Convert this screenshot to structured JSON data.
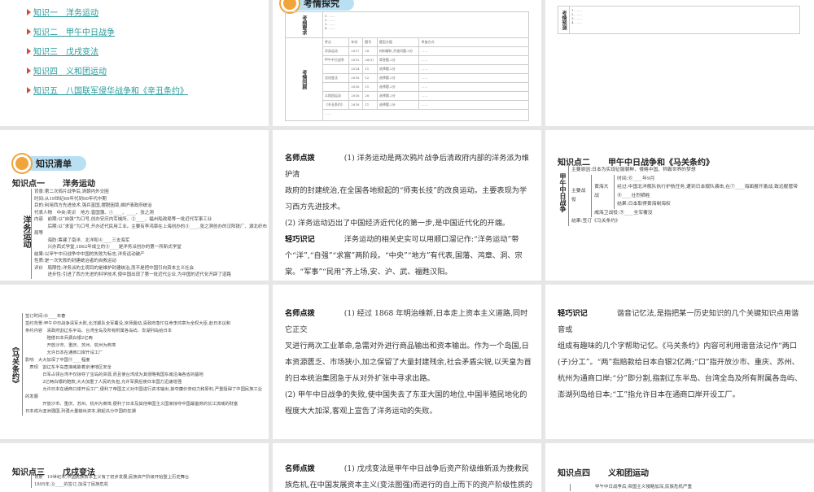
{
  "toc": {
    "items": [
      "知识一　洋务运动",
      "知识二　甲午中日战争",
      "知识三　戊戌变法",
      "知识四　义和团运动",
      "知识五　八国联军侵华战争和《辛丑条约》"
    ]
  },
  "exam": {
    "badge": "考情探究",
    "req_label": "考纲要求",
    "review_label": "考情回顾",
    "headers": [
      "考点",
      "年份",
      "题号",
      "题型分值",
      "考查方式"
    ],
    "rows": [
      [
        "洋务运动",
        "2017",
        "28",
        "材料解析,开放问题,9分"
      ],
      [
        "甲午中日战争",
        "2015",
        "28(1)",
        "简答题,2分"
      ],
      [
        "",
        "2014",
        "11",
        "选择题,2分"
      ],
      [
        "戊戌变法",
        "2018",
        "12",
        "选择题,2分"
      ],
      [
        "",
        "2016",
        "11",
        "选择题,2分"
      ],
      [
        "义和团运动",
        "2016",
        "28",
        "选择题,2分"
      ],
      [
        "《辛丑条约》",
        "2018",
        "11",
        "选择题,2分"
      ]
    ],
    "forecast_label": "考情预测"
  },
  "list": {
    "badge": "知识清单",
    "k1_num": "知识点一",
    "k1_title": "洋务运动",
    "k1_side": "洋务运动",
    "k1_lines": [
      "背景:第二次鸦片战争后,清朝内外交困",
      "时间:从19世纪60年代到90年代中期",
      "目的:利用西方先进技术,强兵富国,摆脱困境,维护清政府统治",
      "代表人物　中央:奕䜣　地方:曾国藩、①____、____、张之洞",
      "内容　前期:以“自强”为口号,创办安庆内军械所、②____、福州船政局等一批近代军事工业",
      "　　　后期:以“求富”为口号,开办近代民用工业。主要有李鸿章在上海创办的③____,张之洞创办的汉阳铁厂、湖北织布局等",
      "　　　海防:筹建了南洋、北洋和④____三支海军",
      "　　　兴办西式学堂,1862年成立的⑤____是洋务派创办的第一所新式学堂",
      "结果:以甲午中日战争中中国的失败为标志,洋务运动破产",
      "性质:是一次失败的封建统治者的自救运动",
      "评价　局限性:洋务派的主观目的是维护封建统治,而不是把中国引向资本主义社会",
      "　　　进步性:引进了西方先进的科学技术,使中国出现了第一批近代企业,为中国的近代化开辟了道路"
    ]
  },
  "tip1": {
    "label": "名师点拨",
    "p1": "(1) 洋务运动是两次鸦片战争后清政府内部的洋务派为维护清",
    "p1b": "政府的封建统治,在全国各地掀起的“师夷长技”的改良运动。主要表现为学习西方先进技术。",
    "p2": "(2) 洋务运动迈出了中国经济近代化的第一步,是中国近代化的开端。",
    "label2": "轻巧识记",
    "p3": "洋务运动的相关史实可以用顺口溜记作:“洋务运动”带个“洋”,“自强”“求富”两阶段。“中央”“地方”有代表,国藩、鸿章、洞、宗棠。“军事”“民用”齐上场,安、沪、武、福甦汉阳。"
  },
  "k2": {
    "num": "知识点二",
    "title": "甲午中日战争和《马关条约》",
    "side": "甲午中日战争",
    "lines": [
      "主要原因:日本为实现征服朝鲜、侵略中国、称霸世界的梦想",
      "时间:⑥____年9月",
      "经过:中国北洋舰队执行护航任务,遭到日本舰队袭击,在⑦____海面展开激战,致远舰管带⑧____壮烈牺牲",
      "结果:日本取得黄海制海权",
      "威海卫战役:⑨____全军覆没",
      "结果:签订《马关条约》"
    ],
    "b1": "主要战役",
    "b2": "黄海大战"
  },
  "treaty": {
    "side": "《马关条约》",
    "lines": [
      "签订时间:⑩____年春",
      "签约背景:甲午中日战争清军大败,北洋舰队全军覆没,京师震动,清政府急忙任命李鸿章为全权大臣,赴日本议和",
      "条约内容　清政府割辽东半岛、台湾全岛及所有附属各岛屿、澎湖列岛给日本",
      "　　　　　赔偿日本兵费白银2亿两",
      "　　　　　开放沙市、重庆、苏州、杭州为商埠",
      "　　　　　允许日本在通商口岸开设工厂",
      "影响　大大加深了中国⑪____程度",
      "　表现　割辽东半岛直接威胁着京津地区安全",
      "　　　　日军占领台湾不仅掠夺了宝岛的资源,而且使台湾成为其侵略我国东南沿海各省的基地",
      "　　　　2亿两白银的赔款,大大加重了人民的负担,允许军费后使日本国力迅速增强",
      "　　　　允许日本在通商口岸开设工厂,便利了帝国主义对中国进行资本输出,掠夺廉价劳动力和原料,严重阻碍了中国民族工业的发展",
      "　　　　开放沙市、重庆、苏州、杭州为商埠,便利了日本及其他帝国主义国家掠夺中国最富庶的长江流域的财富",
      "日本成为亚洲强国,列强大量输出资本,掀起瓜分中国的狂潮"
    ]
  },
  "tip2": {
    "label": "名师点拨",
    "p1": "(1) 经过 1868 年明治维新,日本走上资本主义道路,同时它正交",
    "p1b": "叉进行两次工业革命,急需对外进行商品输出和资本输出。作为一个岛国,日本资源匮乏、市场狭小,加之保留了大量封建残余,社会矛盾尖锐,以天皇为首的日本统治集团急于从对外扩张中寻求出路。",
    "p2": "(2) 甲午中日战争的失败,使中国失去了东亚大国的地位,中国半殖民地化的程度大大加深,客观上宣告了洋务运动的失败。"
  },
  "tip3": {
    "label": "轻巧识记",
    "p1": "谐音记忆法,是指把某一历史知识的几个关键知识点用谐音或",
    "p1b": "组成有趣味的几个字帮助记忆。《马关条约》内容可利用谐音法记作“两口(子)分工”。“两”指赔款给日本白银2亿两;“口”指开放沙市、重庆、苏州、杭州为通商口岸;“分”即分割,指割辽东半岛、台湾全岛及所有附属各岛屿、澎湖列岛给日本;“工”指允许日本在通商口岸开设工厂。"
  },
  "k3": {
    "num": "知识点三",
    "title": "戊戌变法",
    "l1": "背景　19世纪末,中国民族资本主义有了初步发展,民族资产阶级开始登上历史舞台",
    "l2": "1895年,⑫____的签订,加深了民族危机"
  },
  "tip4": {
    "label": "名师点拨",
    "p1": "(1) 戊戌变法是甲午中日战争后资产阶级维新派为挽救民族危机,在中国发展资本主义(变法图强)而进行的自上而下的资产阶级性质的"
  },
  "k4": {
    "num": "知识点四",
    "title": "义和团运动",
    "l1": "甲午中日战争后,帝国主义侵略加深,民族危机严重"
  }
}
